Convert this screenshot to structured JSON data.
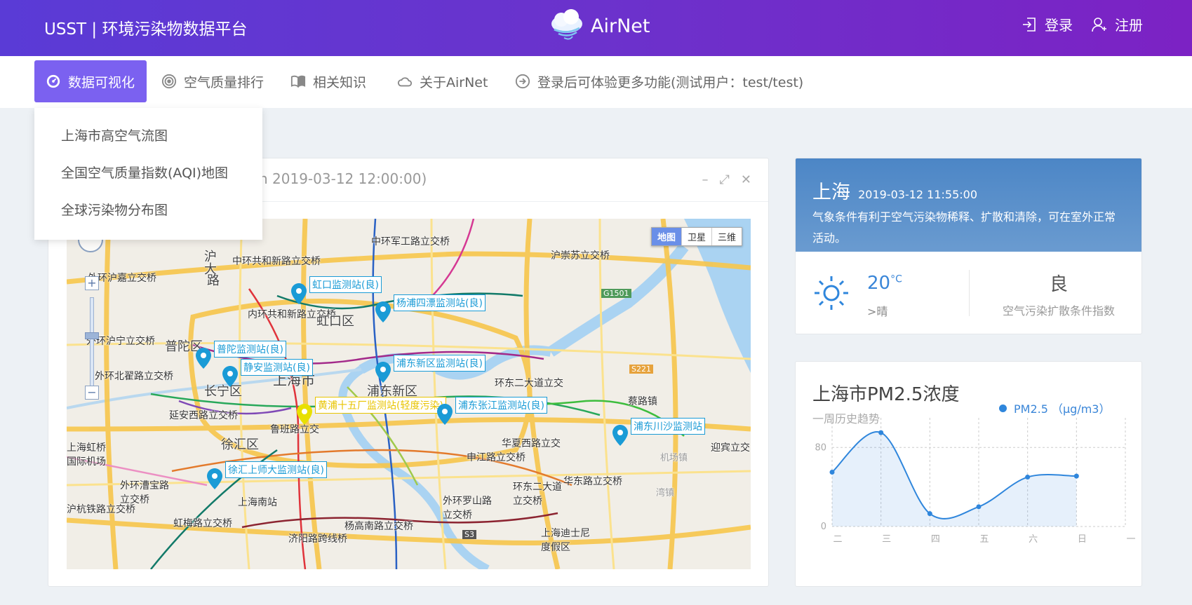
{
  "header": {
    "brand": "USST | 环境污染物数据平台",
    "logo_text": "AirNet",
    "login": "登录",
    "register": "注册"
  },
  "nav": {
    "items": [
      {
        "label": "数据可视化",
        "icon": "dashboard-icon"
      },
      {
        "label": "空气质量排行",
        "icon": "target-icon"
      },
      {
        "label": "相关知识",
        "icon": "book-icon"
      },
      {
        "label": "关于AirNet",
        "icon": "cloud-icon"
      },
      {
        "label": "登录后可体验更多功能(测试用户：test/test)",
        "icon": "arrow-circle-icon"
      }
    ]
  },
  "dropdown": {
    "items": [
      "上海市高空气流图",
      "全国空气质量指数(AQI)地图",
      "全球污染物分布图"
    ]
  },
  "map_card": {
    "title": "n 2019-03-12 12:00:00)",
    "map_types": [
      "地图",
      "卫星",
      "三维"
    ],
    "stations": [
      {
        "label": "虹口监测站(良)",
        "status": "good"
      },
      {
        "label": "杨浦四漂监测站(良)",
        "status": "good"
      },
      {
        "label": "普陀监测站(良)",
        "status": "good"
      },
      {
        "label": "静安监测站(良)",
        "status": "good"
      },
      {
        "label": "浦东新区监测站(良)",
        "status": "good"
      },
      {
        "label": "黄浦十五厂监测站(轻度污染)",
        "status": "light"
      },
      {
        "label": "浦东张江监测站(良)",
        "status": "good"
      },
      {
        "label": "浦东川沙监测站",
        "status": "good"
      },
      {
        "label": "徐汇上师大监测站(良)",
        "status": "good"
      }
    ],
    "places": [
      "中环共和新路立交桥",
      "中环军工路立交桥",
      "沪崇苏立交桥",
      "外环沪嘉立交桥",
      "内环共和新路立交桥",
      "虹口区",
      "外环沪宁立交桥",
      "普陀区",
      "外环北翟路立交桥",
      "上海市",
      "长宁区",
      "浦东新区",
      "环东二大道立交",
      "延安西路立交桥",
      "鲁班路立交",
      "蔡路镇",
      "上海虹桥国际机场",
      "徐汇区",
      "华夏西路立交",
      "申江路立交桥",
      "迎宾立交",
      "外环漕宝路立交桥",
      "环东二大道立交桥",
      "华东路立交桥",
      "上海南站",
      "外环罗山路立交桥",
      "沪杭铁路立交桥",
      "虹梅路立交桥",
      "杨高南路立交桥",
      "济阳路跨线桥",
      "上海迪士尼度假区",
      "沪",
      "大",
      "路",
      "G1501",
      "S221",
      "S3",
      "机场镇",
      "湾镇"
    ]
  },
  "weather": {
    "city": "上海",
    "time": "2019-03-12 11:55:00",
    "description": "气象条件有利于空气污染物稀释、扩散和清除，可在室外正常活动。",
    "temperature": "20",
    "temp_unit": "°C",
    "condition": ">晴",
    "index_value": "良",
    "index_label": "空气污染扩散条件指数"
  },
  "pm_card": {
    "title": "上海市PM2.5浓度",
    "subtitle": "一周历史趋势",
    "legend": "PM2.5 （μg/m3）"
  },
  "chart_data": {
    "type": "line",
    "categories": [
      "二",
      "三",
      "四",
      "五",
      "六",
      "日",
      "一"
    ],
    "series": [
      {
        "name": "PM2.5 （μg/m3）",
        "values": [
          55,
          95,
          13,
          20,
          50,
          51,
          null
        ]
      }
    ],
    "ylim": [
      0,
      110
    ],
    "yticks": [
      0,
      80
    ],
    "smooth": true,
    "area_fill": true,
    "color": "#2f86dc"
  },
  "colors": {
    "header_start": "#5a3bd6",
    "header_end": "#7c22c4",
    "nav_active": "#7b61f0",
    "accent_blue": "#3a86d8",
    "marker_good": "#1a9bd6",
    "marker_light": "#e8e000"
  }
}
